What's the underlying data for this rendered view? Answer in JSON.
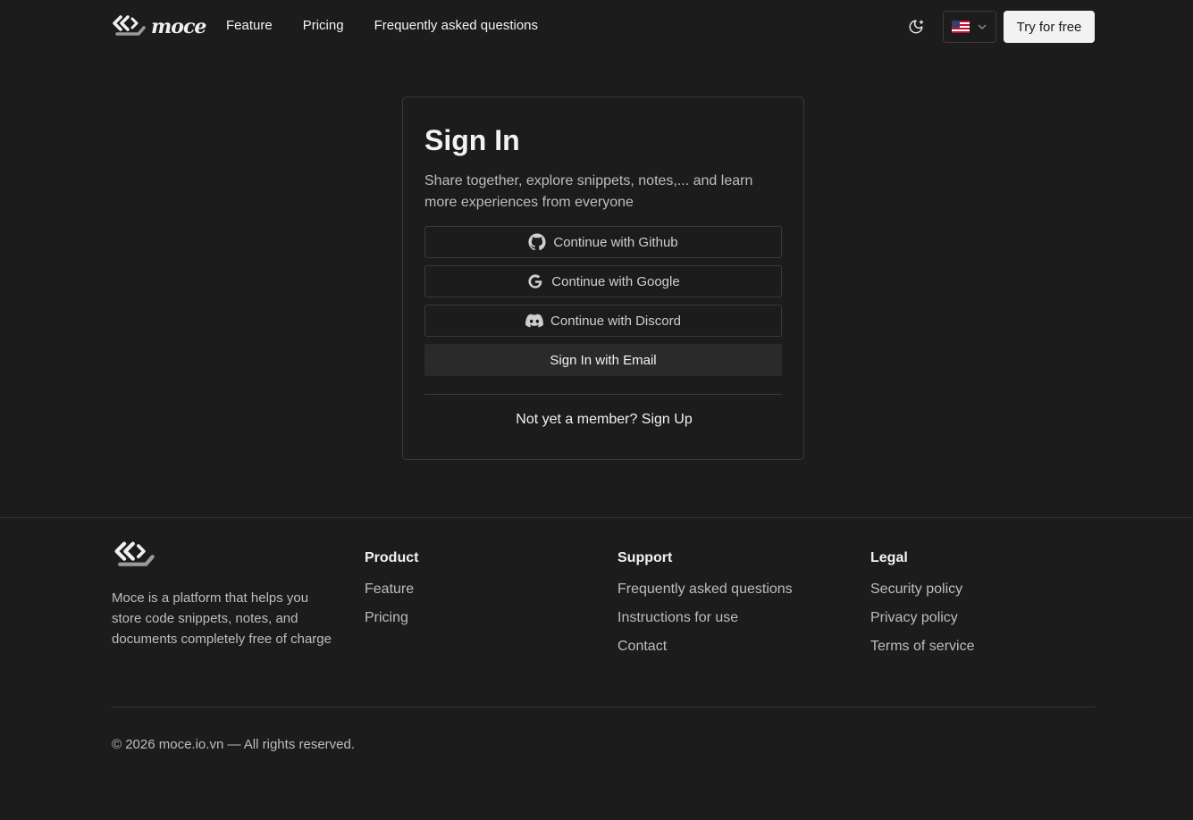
{
  "header": {
    "brand": "moce",
    "nav": [
      {
        "label": "Feature"
      },
      {
        "label": "Pricing"
      },
      {
        "label": "Frequently asked questions"
      }
    ],
    "theme_icon": "moon-sun-icon",
    "language_icon": "us-flag-icon",
    "try_label": "Try for free"
  },
  "card": {
    "title": "Sign In",
    "subtitle": "Share together, explore snippets, notes,... and learn more experiences from everyone",
    "oauth": [
      {
        "label": "Continue with Github",
        "icon": "github-icon"
      },
      {
        "label": "Continue with Google",
        "icon": "google-icon"
      },
      {
        "label": "Continue with Discord",
        "icon": "discord-icon"
      }
    ],
    "email_label": "Sign In with Email",
    "member_text": "Not yet a member?",
    "signup_label": "Sign Up"
  },
  "footer": {
    "description": "Moce is a platform that helps you store code snippets, notes, and documents completely free of charge",
    "columns": [
      {
        "title": "Product",
        "links": [
          "Feature",
          "Pricing"
        ]
      },
      {
        "title": "Support",
        "links": [
          "Frequently asked questions",
          "Instructions for use",
          "Contact"
        ]
      },
      {
        "title": "Legal",
        "links": [
          "Security policy",
          "Privacy policy",
          "Terms of service"
        ]
      }
    ],
    "copyright": "© 2026 moce.io.vn — All rights reserved."
  },
  "colors": {
    "background": "#1c1c1c",
    "border": "#3a3a3a",
    "primary_button": "#f2f2f2"
  }
}
